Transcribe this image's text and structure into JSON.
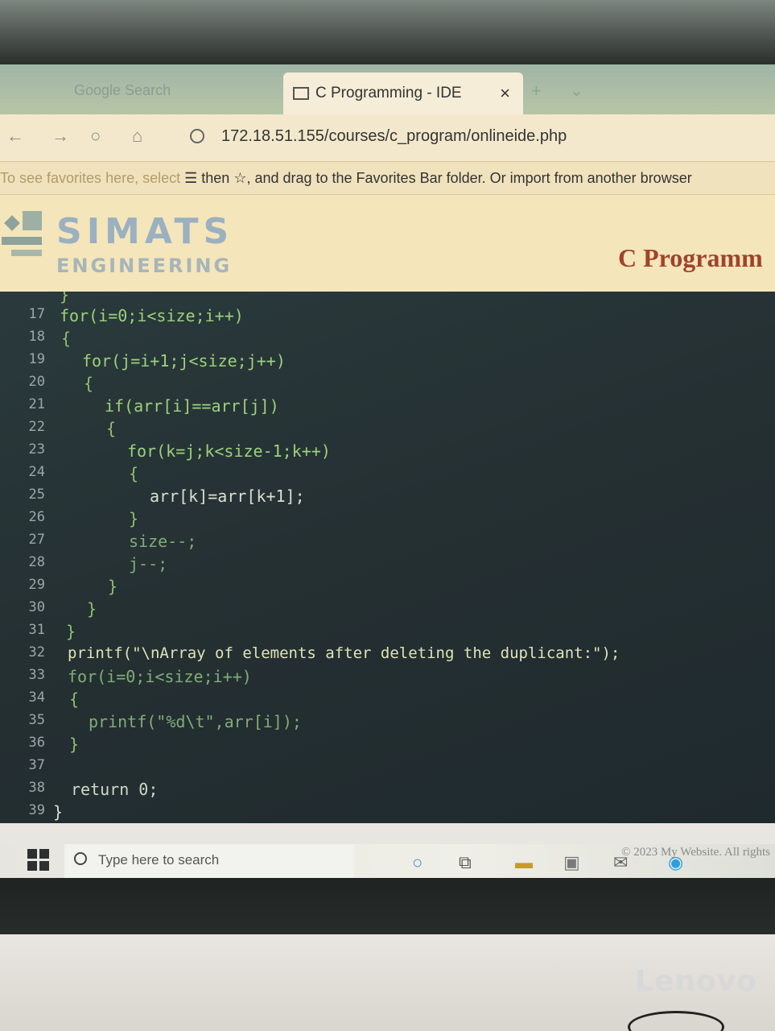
{
  "browser": {
    "ghost_tab": "Google Search",
    "tab_title": "C Programming - IDE",
    "tab_close": "×",
    "new_tab": "+",
    "tab_menu": "⌄",
    "address": "172.18.51.155/courses/c_program/onlineide.php",
    "nav_back": "←",
    "nav_forward": "→",
    "nav_refresh": "○",
    "nav_home": "⌂",
    "favorites_prefix": "To see favorites here, select",
    "favorites_rest": "then ☆, and drag to the Favorites Bar folder. Or import from another browser"
  },
  "site": {
    "logo_top": "SIMATS",
    "logo_bottom": "ENGINEERING",
    "title": "C Programm"
  },
  "editor": {
    "line_numbers": [
      "17",
      "18",
      "19",
      "20",
      "21",
      "22",
      "23",
      "24",
      "25",
      "26",
      "27",
      "28",
      "29",
      "30",
      "31",
      "32",
      "33",
      "34",
      "35",
      "36",
      "37",
      "38",
      "39"
    ],
    "lines": {
      "l16": "}",
      "l17": "for(i=0;i<size;i++)",
      "l18": "{",
      "l19": "for(j=i+1;j<size;j++)",
      "l20": "{",
      "l21": "if(arr[i]==arr[j])",
      "l22": "{",
      "l23": "for(k=j;k<size-1;k++)",
      "l24": "{",
      "l25": "arr[k]=arr[k+1];",
      "l26": "}",
      "l27": "size--;",
      "l28": "j--;",
      "l29": "}",
      "l30": "}",
      "l31": "}",
      "l32": "printf(\"\\nArray of elements after deleting the duplicant:\");",
      "l33": "for(i=0;i<size;i++)",
      "l34": "{",
      "l35": "printf(\"%d\\t\",arr[i]);",
      "l36": "}",
      "l38": "return 0;",
      "l39": "}"
    }
  },
  "taskbar": {
    "search_placeholder": "Type here to search",
    "copyright": "© 2023 My Website. All rights"
  },
  "monitor": {
    "brand": "Lenovo"
  }
}
